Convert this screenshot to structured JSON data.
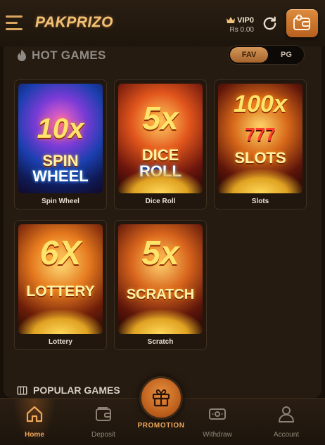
{
  "header": {
    "logo": "PAKPRIZO",
    "vip_label": "VIP0",
    "balance": "Rs 0.00"
  },
  "hot_games": {
    "title": "HOT GAMES",
    "toggle": {
      "fav": "FAV",
      "pg": "PG",
      "active": "FAV"
    },
    "games": [
      {
        "label": "Spin Wheel",
        "art_multiplier": "10x",
        "art_word_1": "SPIN",
        "art_word_2": "WHEEL"
      },
      {
        "label": "Dice Roll",
        "art_multiplier": "5x",
        "art_word_1": "DICE",
        "art_word_2": "ROLL"
      },
      {
        "label": "Slots",
        "art_multiplier": "100x",
        "art_word_1": "777",
        "art_word_2": "SLOTS"
      },
      {
        "label": "Lottery",
        "art_multiplier": "6X",
        "art_word_1": "LOTTERY",
        "art_word_2": ""
      },
      {
        "label": "Scratch",
        "art_multiplier": "5x",
        "art_word_1": "SCRATCH",
        "art_word_2": ""
      }
    ]
  },
  "popular_games": {
    "title": "POPULAR GAMES"
  },
  "bottom_nav": {
    "home": "Home",
    "deposit": "Deposit",
    "promotion": "PROMOTION",
    "withdraw": "Withdraw",
    "account": "Account",
    "active": "Home"
  },
  "colors": {
    "accent": "#f0a65a",
    "background": "#171009",
    "panel": "#261b11"
  },
  "icons": [
    "menu-icon",
    "crown-icon",
    "refresh-icon",
    "wallet-icon",
    "fire-icon",
    "popular-icon",
    "home-icon",
    "deposit-icon",
    "gift-icon",
    "withdraw-icon",
    "account-icon"
  ]
}
